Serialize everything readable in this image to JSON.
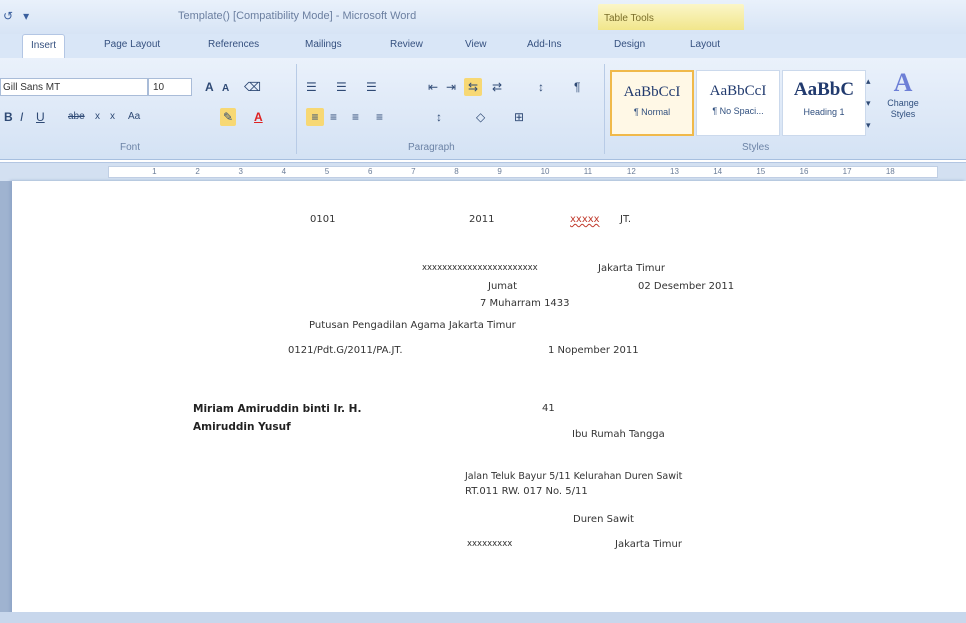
{
  "window": {
    "title": "Template() [Compatibility Mode] - Microsoft Word",
    "contextual_tab_group": "Table Tools"
  },
  "quick_access": {
    "undo_icon": "undo-icon",
    "dropdown_icon": "qat-dropdown-icon"
  },
  "tabs": [
    {
      "label": "Insert"
    },
    {
      "label": "Page Layout"
    },
    {
      "label": "References"
    },
    {
      "label": "Mailings"
    },
    {
      "label": "Review"
    },
    {
      "label": "View"
    },
    {
      "label": "Add-Ins"
    },
    {
      "label": "Design"
    },
    {
      "label": "Layout"
    }
  ],
  "ribbon": {
    "font": {
      "name": "Gill Sans MT",
      "size": "10",
      "group_label": "Font",
      "grow": "A",
      "shrink": "A",
      "bold": "B",
      "italic": "I",
      "underline": "U",
      "strike": "abe",
      "sub": "x",
      "sup": "x",
      "case": "Aa",
      "color": "A"
    },
    "paragraph": {
      "group_label": "Paragraph",
      "pilcrow": "¶"
    },
    "styles": {
      "group_label": "Styles",
      "items": [
        {
          "sample": "AaBbCcI",
          "name": "¶ Normal"
        },
        {
          "sample": "AaBbCcI",
          "name": "¶ No Spaci..."
        },
        {
          "sample": "AaBbC",
          "name": "Heading 1"
        }
      ],
      "change_styles": "Change Styles"
    }
  },
  "ruler": {
    "labels": [
      "1",
      "2",
      "3",
      "4",
      "5",
      "6",
      "7",
      "8",
      "9",
      "10",
      "11",
      "12",
      "13",
      "14",
      "15",
      "16",
      "17",
      "18"
    ]
  },
  "document": {
    "line1": {
      "a": "0101",
      "b": "2011",
      "c": "xxxxx",
      "d": "JT."
    },
    "line2": {
      "a": "xxxxxxxxxxxxxxxxxxxxxxx",
      "b": "Jakarta Timur"
    },
    "line3": {
      "a": "Jumat",
      "b": "02 Desember  2011"
    },
    "line4": "7 Muharram 1433",
    "line5": "Putusan Pengadilan Agama Jakarta Timur",
    "line6": {
      "a": "0121/Pdt.G/2011/PA.JT.",
      "b": "1 Nopember 2011"
    },
    "name1": "Miriam Amiruddin binti Ir. H.",
    "name2": "Amiruddin Yusuf",
    "age": "41",
    "occupation": "Ibu Rumah Tangga",
    "address1": "Jalan  Teluk  Bayur  5/11  Kelurahan  Duren  Sawit",
    "address2": "RT.011 RW. 017 No. 5/11",
    "district": "Duren Sawit",
    "last": {
      "a": "xxxxxxxxx",
      "b": "Jakarta Timur"
    }
  }
}
